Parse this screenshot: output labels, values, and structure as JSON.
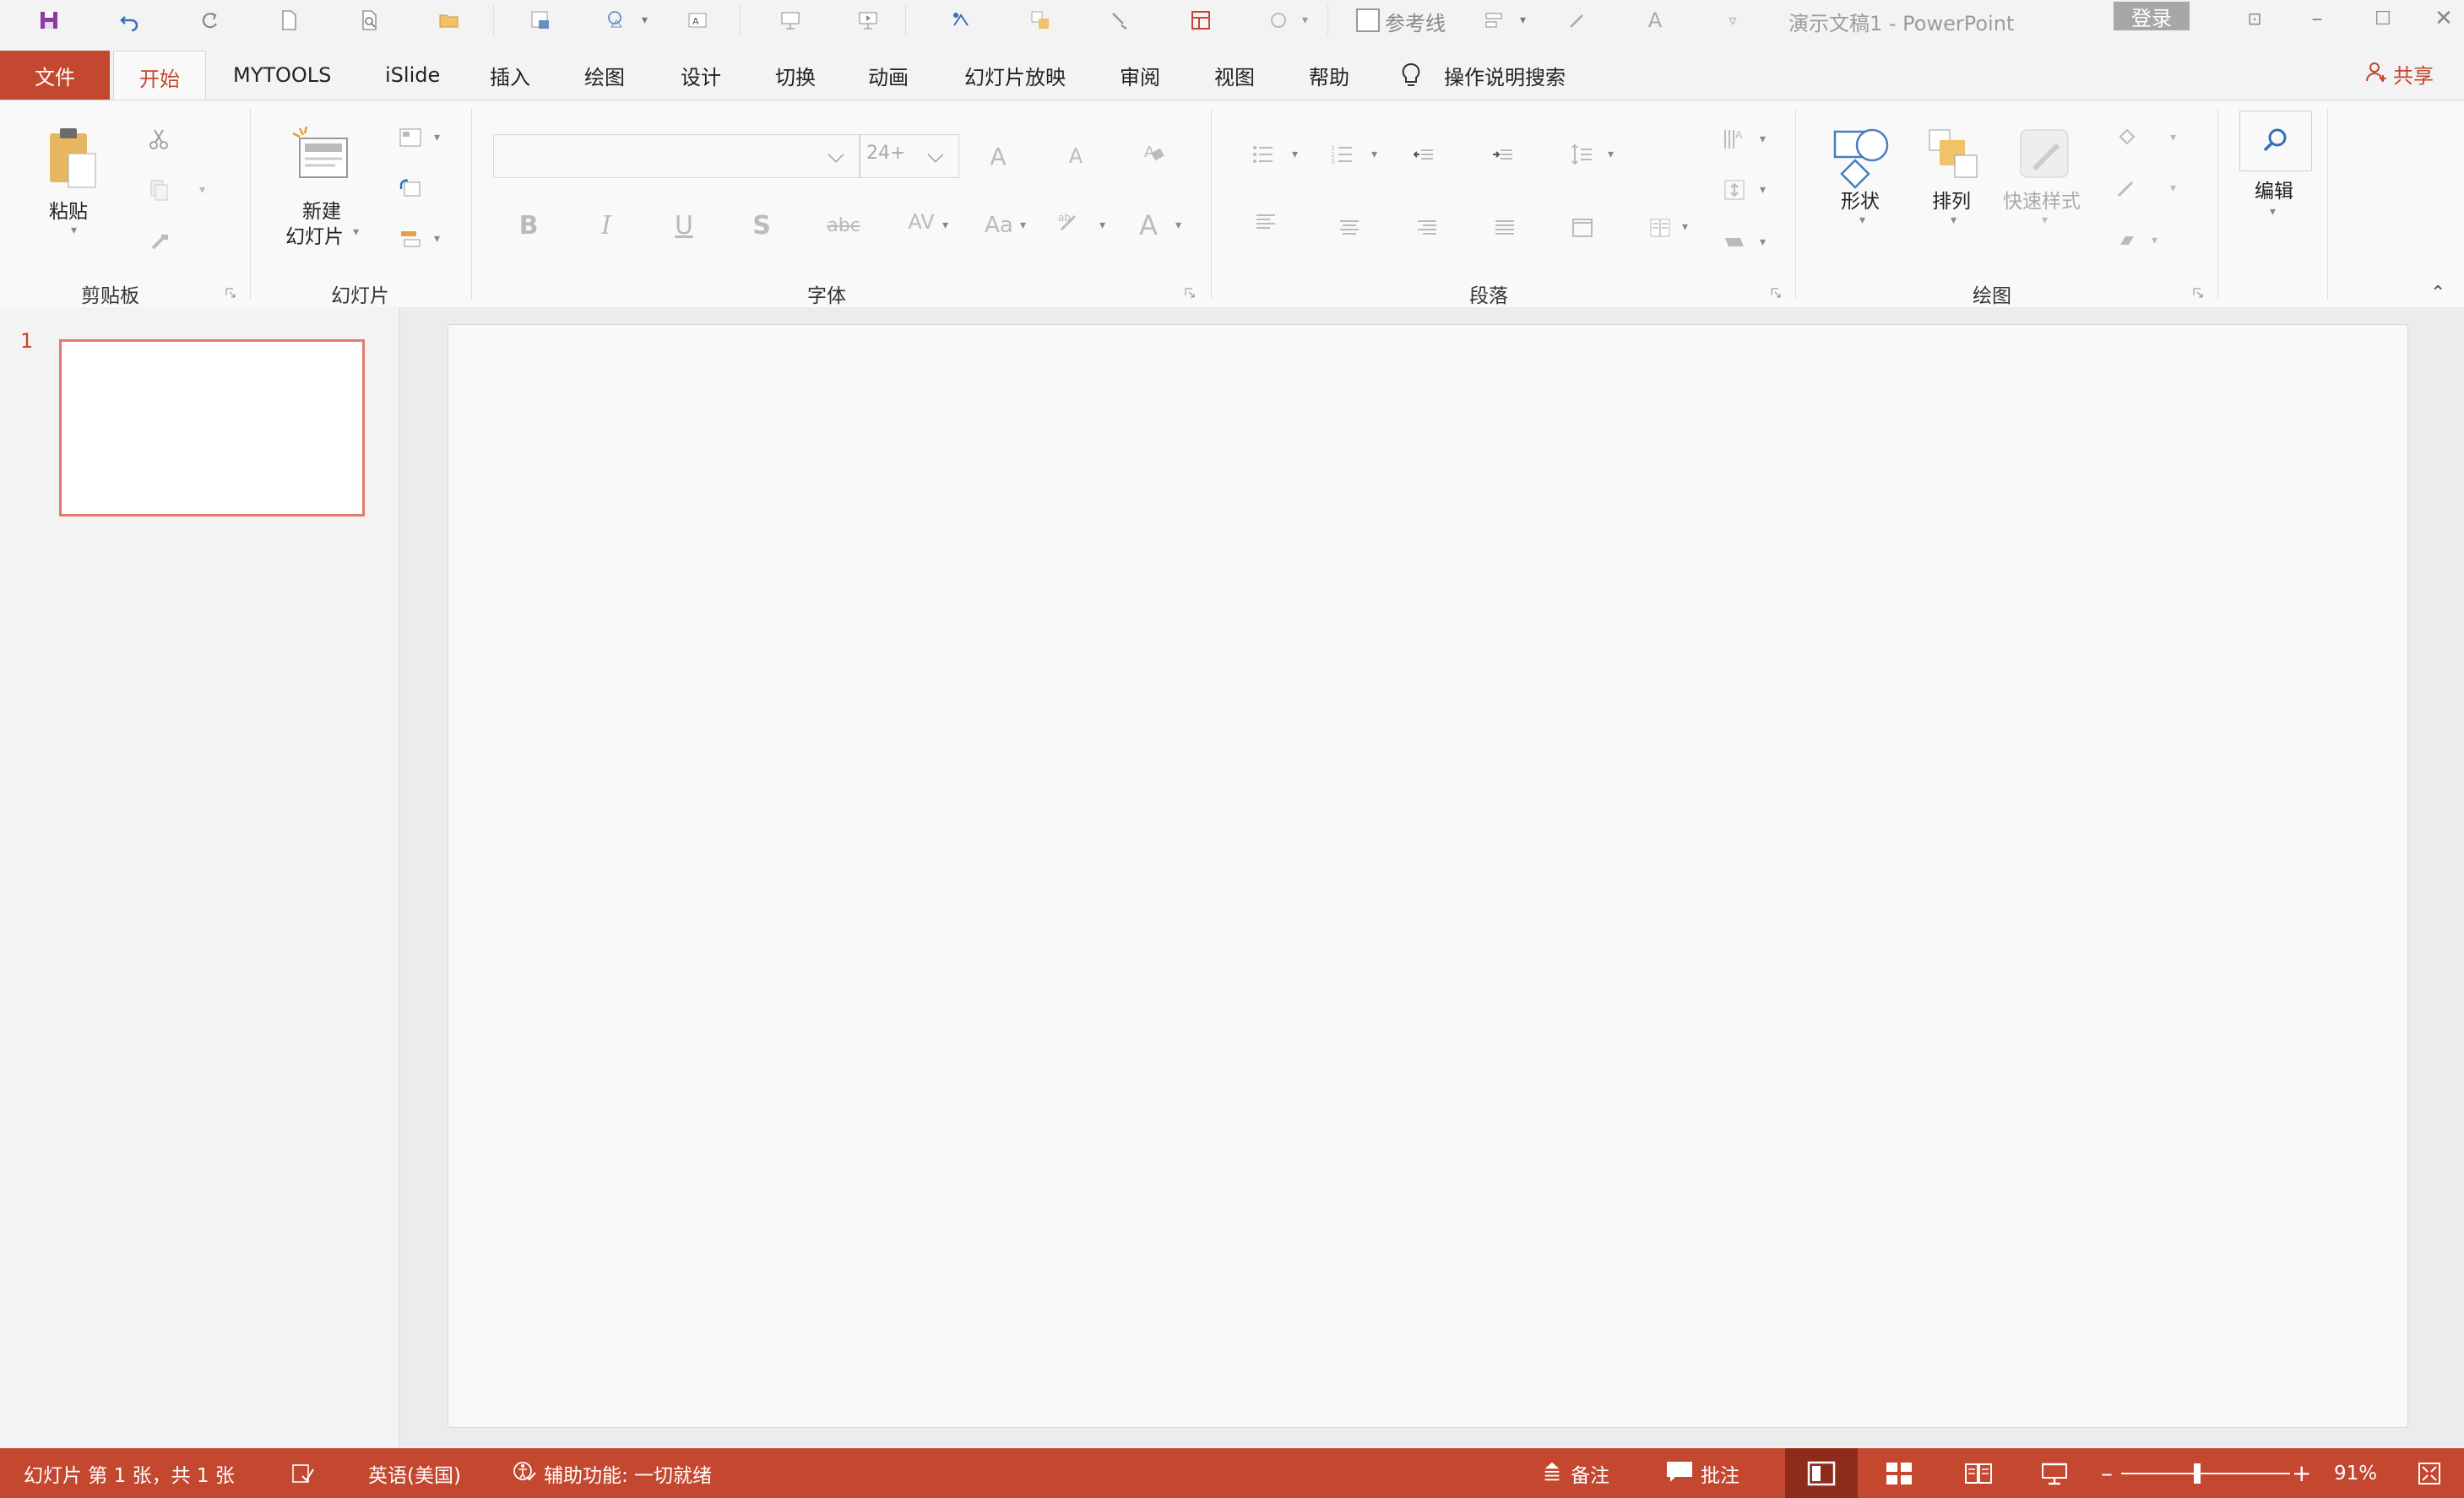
{
  "titlebar": {
    "doc_title": "演示文稿1  -  PowerPoint",
    "login_label": "登录",
    "guides_label": "参考线"
  },
  "tabs": [
    {
      "label": "文件"
    },
    {
      "label": "开始"
    },
    {
      "label": "MYTOOLS"
    },
    {
      "label": "iSlide"
    },
    {
      "label": "插入"
    },
    {
      "label": "绘图"
    },
    {
      "label": "设计"
    },
    {
      "label": "切换"
    },
    {
      "label": "动画"
    },
    {
      "label": "幻灯片放映"
    },
    {
      "label": "审阅"
    },
    {
      "label": "视图"
    },
    {
      "label": "帮助"
    }
  ],
  "search_label": "操作说明搜索",
  "share_label": "共享",
  "ribbon": {
    "clipboard": {
      "group": "剪贴板",
      "paste": "粘贴"
    },
    "slides": {
      "group": "幻灯片",
      "new_slide_1": "新建",
      "new_slide_2": "幻灯片"
    },
    "font": {
      "group": "字体",
      "font_size": "24+",
      "bold": "B",
      "italic": "I",
      "underline": "U",
      "shadow": "S",
      "strike": "abc",
      "spacing": "AV",
      "case": "Aa",
      "color": "A",
      "grow": "A",
      "shrink": "A"
    },
    "paragraph": {
      "group": "段落"
    },
    "drawing": {
      "group": "绘图",
      "shapes": "形状",
      "arrange": "排列",
      "quick_styles": "快速样式"
    },
    "editing": {
      "label": "编辑"
    }
  },
  "slide_pane": {
    "slide_number": "1"
  },
  "statusbar": {
    "slide_info": "幻灯片 第 1 张，共 1 张",
    "language": "英语(美国)",
    "accessibility": "辅助功能: 一切就绪",
    "notes": "备注",
    "comments": "批注",
    "zoom": "91%"
  },
  "colors": {
    "accent": "#c4472f",
    "accent_dark": "#8e2b1a"
  }
}
